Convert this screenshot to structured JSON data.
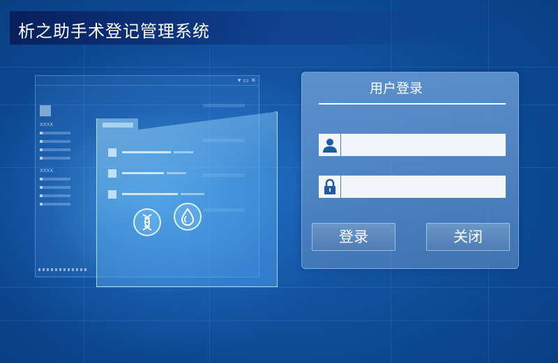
{
  "app": {
    "title": "析之助手术登记管理系统"
  },
  "illustration": {
    "list_label_1": "XXXX",
    "list_label_2": "XXXX",
    "window_controls": "▾ ▭ ✕"
  },
  "login": {
    "title": "用户登录",
    "username": {
      "value": "",
      "placeholder": "",
      "icon": "user-icon"
    },
    "password": {
      "value": "",
      "placeholder": "",
      "icon": "lock-icon"
    },
    "login_button": "登录",
    "close_button": "关闭"
  },
  "colors": {
    "background": "#0c4891",
    "panel": "#5f8fc8",
    "field_icon": "#1f5aa6"
  }
}
